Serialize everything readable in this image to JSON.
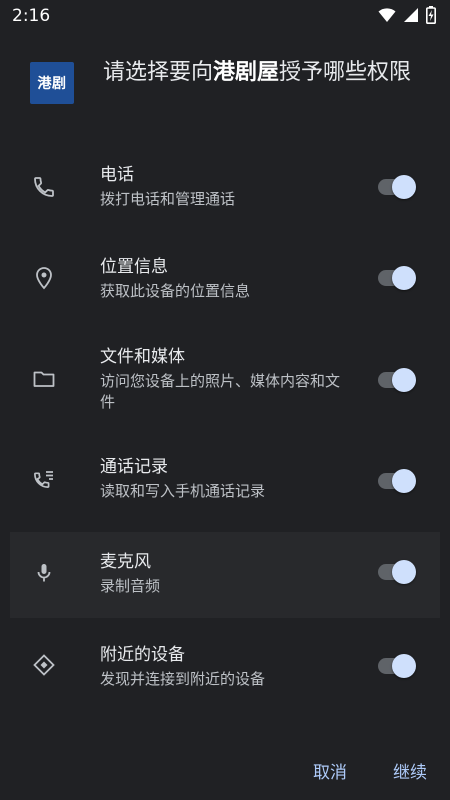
{
  "status_bar": {
    "time": "2:16",
    "icons": [
      "wifi-icon",
      "signal-icon",
      "battery-charging-icon"
    ]
  },
  "header": {
    "app_icon_text": "港剧",
    "title_prefix": "请选择要向",
    "app_name": "港剧屋",
    "title_suffix": "授予哪些权限"
  },
  "permissions": [
    {
      "icon": "phone-icon",
      "title": "电话",
      "description": "拨打电话和管理通话",
      "enabled": true
    },
    {
      "icon": "location-icon",
      "title": "位置信息",
      "description": "获取此设备的位置信息",
      "enabled": true
    },
    {
      "icon": "folder-icon",
      "title": "文件和媒体",
      "description": "访问您设备上的照片、媒体内容和文件",
      "enabled": true
    },
    {
      "icon": "call-log-icon",
      "title": "通话记录",
      "description": "读取和写入手机通话记录",
      "enabled": true
    },
    {
      "icon": "microphone-icon",
      "title": "麦克风",
      "description": "录制音频",
      "enabled": true
    },
    {
      "icon": "nearby-devices-icon",
      "title": "附近的设备",
      "description": "发现并连接到附近的设备",
      "enabled": true
    }
  ],
  "footer": {
    "cancel_label": "取消",
    "continue_label": "继续"
  },
  "colors": {
    "background": "#202124",
    "accent": "#aecbfa",
    "toggle_thumb": "#cfe0fc",
    "app_icon_bg": "#1f4f97"
  }
}
